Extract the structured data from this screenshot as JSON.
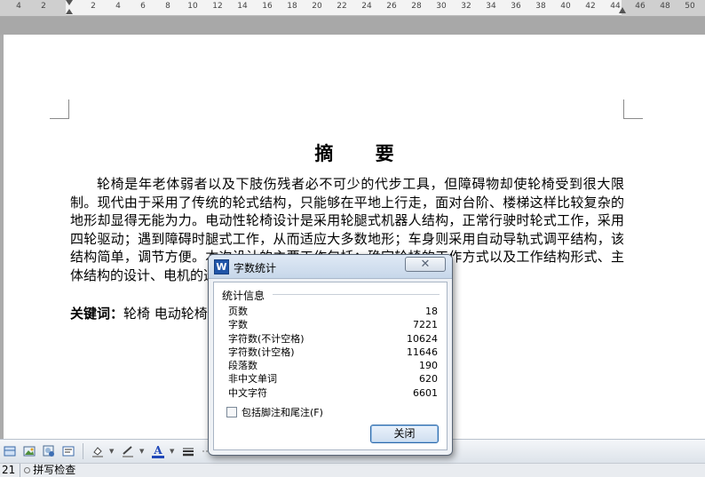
{
  "ruler": {
    "ticks": [
      "4",
      "2",
      "2",
      "4",
      "6",
      "8",
      "10",
      "12",
      "14",
      "16",
      "18",
      "20",
      "22",
      "24",
      "26",
      "28",
      "30",
      "32",
      "34",
      "36",
      "38",
      "40",
      "42",
      "44",
      "46",
      "48",
      "50"
    ]
  },
  "document": {
    "title": "摘  要",
    "paragraph": "轮椅是年老体弱者以及下肢伤残者必不可少的代步工具，但障碍物却使轮椅受到很大限制。现代由于采用了传统的轮式结构，只能够在平地上行走，面对台阶、楼梯这样比较复杂的地形却显得无能为力。电动性轮椅设计是采用轮腿式机器人结构，正常行驶时轮式工作，采用四轮驱动；遇到障碍时腿式工作，从而适应大多数地形；车身则采用自动导轨式调平结构，该结构简单，调节方便。本次设计的主要工作包括：确定轮椅的工作方式以及工作结构形式、主体结构的设计、电机的选择以及主要零件尺寸及其选型。",
    "keywords_label": "关键词：",
    "keywords": "轮椅  电动轮椅"
  },
  "dialog": {
    "title": "字数统计",
    "group_label": "统计信息",
    "stats": [
      {
        "label": "页数",
        "value": "18"
      },
      {
        "label": "字数",
        "value": "7221"
      },
      {
        "label": "字符数(不计空格)",
        "value": "10624"
      },
      {
        "label": "字符数(计空格)",
        "value": "11646"
      },
      {
        "label": "段落数",
        "value": "190"
      },
      {
        "label": "非中文单词",
        "value": "620"
      },
      {
        "label": "中文字符",
        "value": "6601"
      }
    ],
    "include_label": "包括脚注和尾注(F)",
    "include_checked": false,
    "close_button": "关闭"
  },
  "statusbar": {
    "page_number": "21",
    "spellcheck": "拼写检查"
  },
  "colors": {
    "dialog_icon": "#2055a8",
    "font_color_icon": "#1f47b8"
  }
}
